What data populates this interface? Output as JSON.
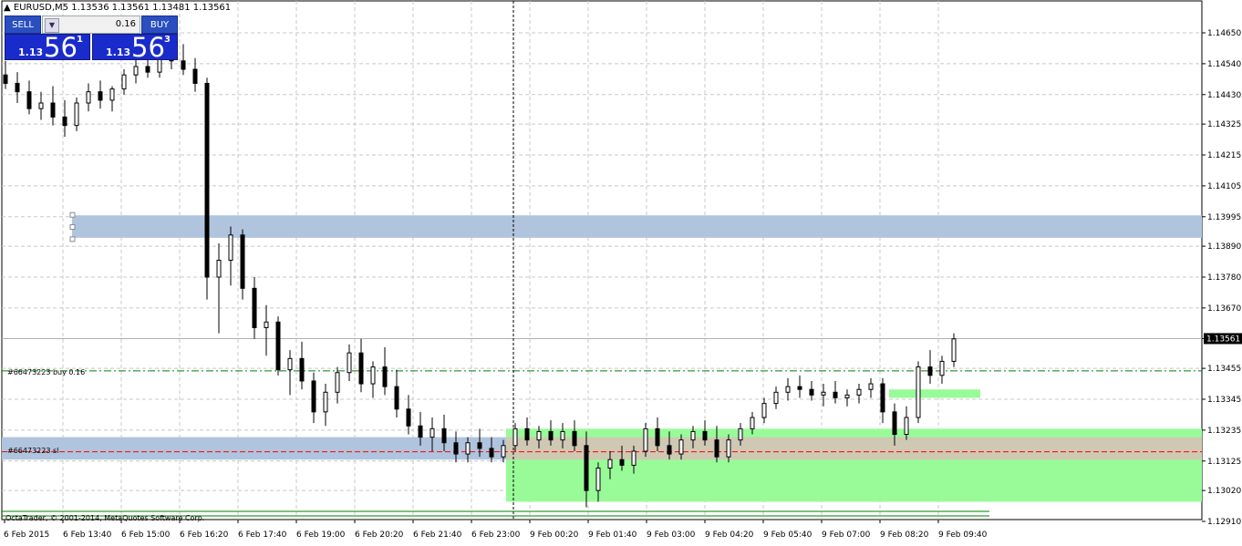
{
  "header": {
    "symbol_label": "EURUSD,M5",
    "ohlc": "1.13536 1.13561 1.13481 1.13561",
    "arrow_icon": "triangle-up-icon"
  },
  "trade_panel": {
    "sell_label": "SELL",
    "buy_label": "BUY",
    "volume": "0.16",
    "sell_prefix": "1.13",
    "sell_big": "56",
    "sell_sup": "1",
    "buy_prefix": "1.13",
    "buy_big": "56",
    "buy_sup": "3"
  },
  "orders": {
    "buy_label": "#66473223 buy 0.16",
    "sl_label": "#66473223 sl"
  },
  "footer": {
    "copyright": "OctaTrader, © 2001-2014, MetaQuotes Software Corp."
  },
  "colors": {
    "up_candle": "#ffffff",
    "down_candle": "#000000",
    "grid": "#c8c8c8",
    "supply_zone": "#b0c4de",
    "demand_zone": "#98fb98",
    "overlap_zone": "#d8c0b8",
    "buy_line": "#008000",
    "sl_line": "#ff0000",
    "current_price_bg": "#000000"
  },
  "chart_data": {
    "type": "candlestick",
    "symbol": "EURUSD",
    "timeframe": "M5",
    "current_price": 1.13561,
    "y_ticks": [
      "1.14650",
      "1.14540",
      "1.14430",
      "1.14325",
      "1.14215",
      "1.14105",
      "1.13995",
      "1.13890",
      "1.13780",
      "1.13670",
      "1.13561",
      "1.13455",
      "1.13345",
      "1.13235",
      "1.13125",
      "1.13020",
      "1.12910"
    ],
    "y_range": [
      1.1288,
      1.147
    ],
    "x_ticks": [
      "6 Feb 2015",
      "6 Feb 13:40",
      "6 Feb 15:00",
      "6 Feb 16:20",
      "6 Feb 17:40",
      "6 Feb 19:00",
      "6 Feb 20:20",
      "6 Feb 21:40",
      "6 Feb 23:00",
      "9 Feb 00:20",
      "9 Feb 01:40",
      "9 Feb 03:00",
      "9 Feb 04:20",
      "9 Feb 05:40",
      "9 Feb 07:00",
      "9 Feb 08:20",
      "9 Feb 09:40"
    ],
    "zones": [
      {
        "name": "supply",
        "top": 1.14,
        "bottom": 1.1392
      },
      {
        "name": "lower-band",
        "top": 1.1321,
        "bottom": 1.1313
      },
      {
        "name": "demand",
        "top": 1.1324,
        "bottom": 1.1298
      },
      {
        "name": "small-demand",
        "top": 1.1338,
        "bottom": 1.1335
      }
    ],
    "buy_level": 1.13446,
    "sl_level": 1.13158,
    "candles": [
      [
        1.145,
        1.1455,
        1.1445,
        1.1447
      ],
      [
        1.1447,
        1.1451,
        1.144,
        1.1444
      ],
      [
        1.1444,
        1.1448,
        1.1436,
        1.1438
      ],
      [
        1.1438,
        1.1444,
        1.1434,
        1.144
      ],
      [
        1.144,
        1.1446,
        1.1432,
        1.1435
      ],
      [
        1.1435,
        1.1441,
        1.1428,
        1.1432
      ],
      [
        1.1432,
        1.1442,
        1.143,
        1.144
      ],
      [
        1.144,
        1.1447,
        1.1437,
        1.1444
      ],
      [
        1.1444,
        1.1448,
        1.1438,
        1.1441
      ],
      [
        1.1441,
        1.1446,
        1.1437,
        1.1445
      ],
      [
        1.1445,
        1.1452,
        1.1443,
        1.145
      ],
      [
        1.145,
        1.1456,
        1.1447,
        1.1453
      ],
      [
        1.1453,
        1.1458,
        1.1449,
        1.1451
      ],
      [
        1.1451,
        1.1459,
        1.1449,
        1.1457
      ],
      [
        1.1457,
        1.1462,
        1.1452,
        1.1455
      ],
      [
        1.1455,
        1.1461,
        1.145,
        1.1452
      ],
      [
        1.1452,
        1.1456,
        1.1444,
        1.1447
      ],
      [
        1.1447,
        1.1449,
        1.137,
        1.1378
      ],
      [
        1.1378,
        1.139,
        1.1358,
        1.1384
      ],
      [
        1.1384,
        1.1396,
        1.1375,
        1.1393
      ],
      [
        1.1393,
        1.1395,
        1.137,
        1.1374
      ],
      [
        1.1374,
        1.1378,
        1.1356,
        1.136
      ],
      [
        1.136,
        1.1368,
        1.135,
        1.1362
      ],
      [
        1.1362,
        1.1364,
        1.1343,
        1.1345
      ],
      [
        1.1345,
        1.1352,
        1.1336,
        1.1349
      ],
      [
        1.1349,
        1.1355,
        1.1338,
        1.1341
      ],
      [
        1.1341,
        1.1344,
        1.1326,
        1.133
      ],
      [
        1.133,
        1.134,
        1.1325,
        1.1337
      ],
      [
        1.1337,
        1.1346,
        1.1333,
        1.1344
      ],
      [
        1.1344,
        1.1354,
        1.1341,
        1.1351
      ],
      [
        1.1351,
        1.1356,
        1.1337,
        1.134
      ],
      [
        1.134,
        1.1348,
        1.1335,
        1.1346
      ],
      [
        1.1346,
        1.1353,
        1.1336,
        1.1339
      ],
      [
        1.1339,
        1.1345,
        1.1328,
        1.1331
      ],
      [
        1.1331,
        1.1336,
        1.1322,
        1.1325
      ],
      [
        1.1325,
        1.133,
        1.1318,
        1.1321
      ],
      [
        1.1321,
        1.1328,
        1.1316,
        1.1324
      ],
      [
        1.1324,
        1.1329,
        1.1316,
        1.1319
      ],
      [
        1.1319,
        1.1323,
        1.1312,
        1.1315
      ],
      [
        1.1315,
        1.1321,
        1.1312,
        1.1319
      ],
      [
        1.1319,
        1.1324,
        1.1314,
        1.1317
      ],
      [
        1.1317,
        1.1321,
        1.1312,
        1.1314
      ],
      [
        1.1314,
        1.132,
        1.1312,
        1.1318
      ],
      [
        1.1318,
        1.1326,
        1.1316,
        1.1324
      ],
      [
        1.1324,
        1.1328,
        1.1318,
        1.132
      ],
      [
        1.132,
        1.1325,
        1.1317,
        1.1323
      ],
      [
        1.1323,
        1.1327,
        1.1318,
        1.132
      ],
      [
        1.132,
        1.1326,
        1.1317,
        1.1323
      ],
      [
        1.1323,
        1.1327,
        1.1316,
        1.1318
      ],
      [
        1.1318,
        1.1323,
        1.1296,
        1.1302
      ],
      [
        1.1302,
        1.1312,
        1.1298,
        1.131
      ],
      [
        1.131,
        1.1316,
        1.1306,
        1.1313
      ],
      [
        1.1313,
        1.1318,
        1.1309,
        1.1311
      ],
      [
        1.1311,
        1.1318,
        1.1308,
        1.1316
      ],
      [
        1.1316,
        1.1326,
        1.1314,
        1.1324
      ],
      [
        1.1324,
        1.1328,
        1.1316,
        1.1318
      ],
      [
        1.1318,
        1.1323,
        1.1313,
        1.1315
      ],
      [
        1.1315,
        1.1322,
        1.1313,
        1.132
      ],
      [
        1.132,
        1.1325,
        1.1317,
        1.1323
      ],
      [
        1.1323,
        1.1327,
        1.1318,
        1.132
      ],
      [
        1.132,
        1.1325,
        1.1312,
        1.1314
      ],
      [
        1.1314,
        1.1322,
        1.1312,
        1.132
      ],
      [
        1.132,
        1.1326,
        1.1318,
        1.1324
      ],
      [
        1.1324,
        1.133,
        1.1322,
        1.1328
      ],
      [
        1.1328,
        1.1335,
        1.1326,
        1.1333
      ],
      [
        1.1333,
        1.1339,
        1.1331,
        1.1337
      ],
      [
        1.1337,
        1.1342,
        1.1334,
        1.1339
      ],
      [
        1.1339,
        1.1343,
        1.1335,
        1.1338
      ],
      [
        1.1338,
        1.1341,
        1.1334,
        1.1336
      ],
      [
        1.1336,
        1.134,
        1.1332,
        1.1337
      ],
      [
        1.1337,
        1.1341,
        1.1333,
        1.1335
      ],
      [
        1.1335,
        1.1338,
        1.1332,
        1.1336
      ],
      [
        1.1336,
        1.134,
        1.1333,
        1.1338
      ],
      [
        1.1338,
        1.1342,
        1.1335,
        1.134
      ],
      [
        1.134,
        1.1342,
        1.1326,
        1.133
      ],
      [
        1.133,
        1.1333,
        1.1318,
        1.1322
      ],
      [
        1.1322,
        1.1332,
        1.132,
        1.1328
      ],
      [
        1.1328,
        1.1348,
        1.1326,
        1.1346
      ],
      [
        1.1346,
        1.1352,
        1.134,
        1.1343
      ],
      [
        1.1343,
        1.135,
        1.134,
        1.1348
      ],
      [
        1.1348,
        1.1358,
        1.1346,
        1.1356
      ]
    ]
  }
}
